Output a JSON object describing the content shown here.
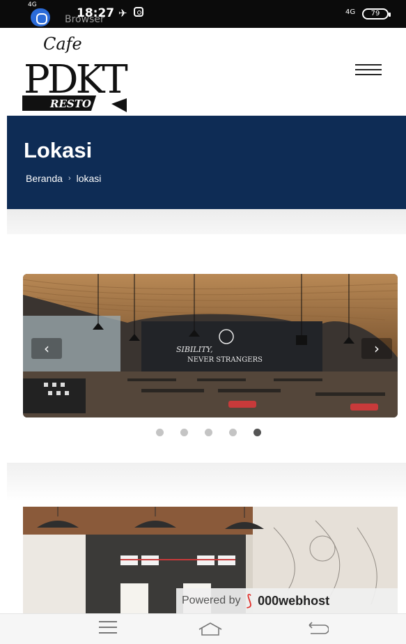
{
  "status_bar": {
    "network": "4G",
    "app_name": "Browser",
    "time": "18:27",
    "signal": "4G",
    "battery": "79",
    "icons": [
      "app-icon",
      "twitter-icon",
      "instagram-icon"
    ]
  },
  "header": {
    "logo_top": "Cafe",
    "logo_main": "PDKT",
    "logo_bottom": "RESTO",
    "menu_icon": "hamburger-menu-icon"
  },
  "banner": {
    "title": "Lokasi",
    "breadcrumb": {
      "home": "Beranda",
      "separator": "›",
      "current": "lokasi"
    },
    "color": "#0e2c55"
  },
  "slider": {
    "wall_text_1": "SIBILITY,",
    "wall_text_2": "NEVER STRANGERS",
    "prev_label": "‹",
    "next_label": "›",
    "slide_count": 5,
    "active_index": 4
  },
  "footer_badge": {
    "by": "Powered by",
    "host": "000webhost"
  },
  "nav_bar": {
    "icons": [
      "recent-apps-icon",
      "home-icon",
      "back-icon"
    ]
  }
}
